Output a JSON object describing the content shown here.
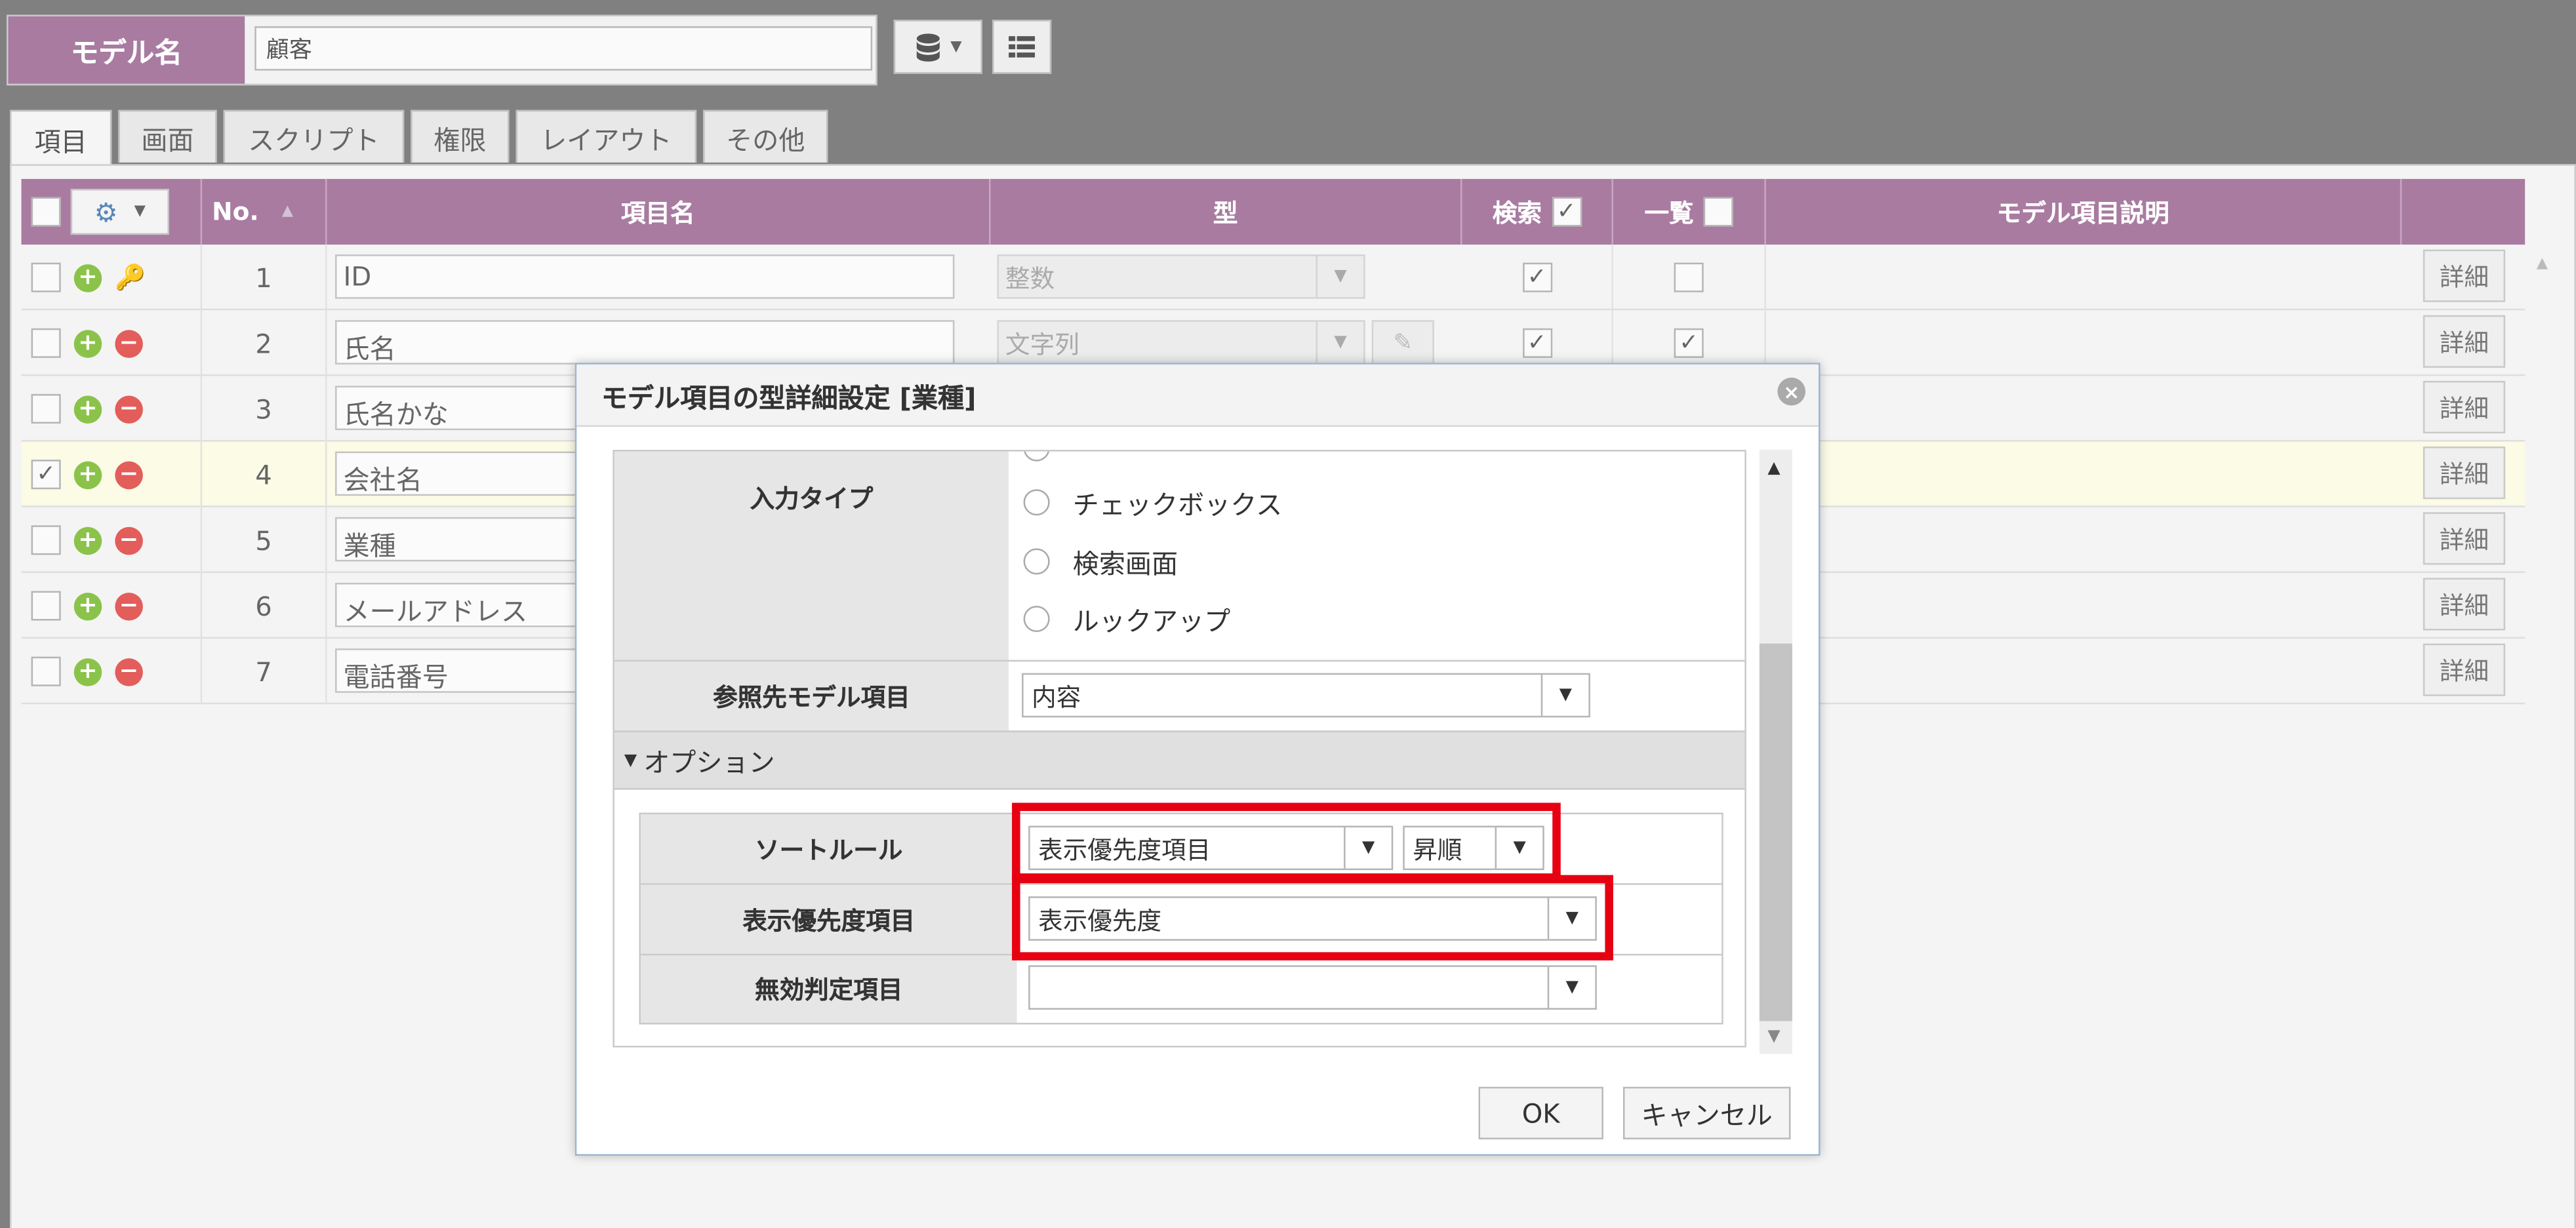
{
  "model": {
    "label": "モデル名",
    "value": "顧客"
  },
  "tabs": [
    "項目",
    "画面",
    "スクリプト",
    "権限",
    "レイアウト",
    "その他"
  ],
  "grid": {
    "headers": {
      "no": "No.",
      "name": "項目名",
      "type": "型",
      "search": "検索",
      "list": "一覧",
      "desc": "モデル項目説明"
    },
    "detail_label": "詳細",
    "rows": [
      {
        "no": "1",
        "name": "ID",
        "type": "整数"
      },
      {
        "no": "2",
        "name": "氏名",
        "type": "文字列"
      },
      {
        "no": "3",
        "name": "氏名かな"
      },
      {
        "no": "4",
        "name": "会社名"
      },
      {
        "no": "5",
        "name": "業種"
      },
      {
        "no": "6",
        "name": "メールアドレス"
      },
      {
        "no": "7",
        "name": "電話番号"
      }
    ]
  },
  "dialog": {
    "title": "モデル項目の型詳細設定 [業種]",
    "input_type_label": "入力タイプ",
    "input_type_options": [
      "チェックボックス",
      "検索画面",
      "ルックアップ"
    ],
    "ref_field_label": "参照先モデル項目",
    "ref_field_value": "内容",
    "options_header": "オプション",
    "sort_rule_label": "ソートルール",
    "sort_rule_field": "表示優先度項目",
    "sort_rule_order": "昇順",
    "priority_label": "表示優先度項目",
    "priority_value": "表示優先度",
    "invalid_label": "無効判定項目",
    "invalid_value": "",
    "ok": "OK",
    "cancel": "キャンセル"
  },
  "colors": {
    "header": "#a97ba1",
    "highlight": "#e60012",
    "selected_row": "#fbfbe6"
  }
}
